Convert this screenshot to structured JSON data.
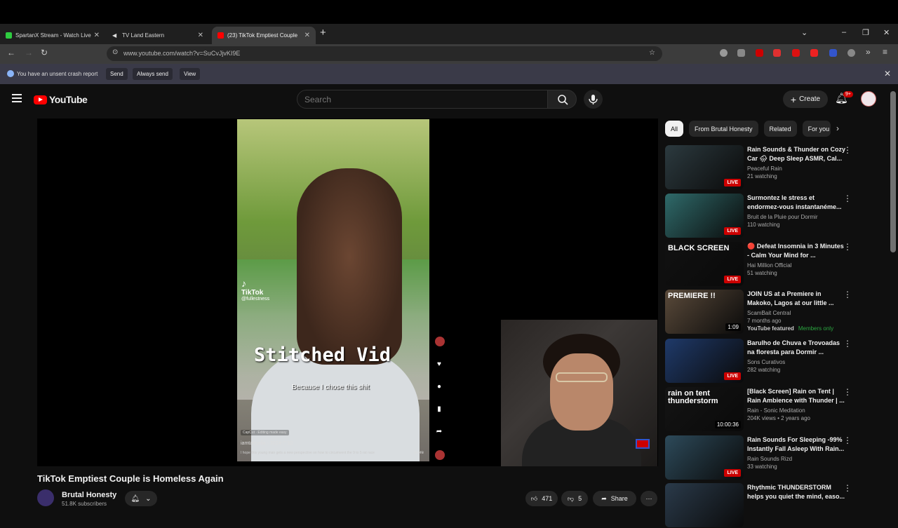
{
  "browser": {
    "tabs": [
      {
        "title": "SpartanX Stream - Watch Live o",
        "active": false,
        "color": "#2ecc40"
      },
      {
        "title": "TV Land Eastern",
        "active": false,
        "color": "#bbbbbb"
      },
      {
        "title": "(23) TikTok Emptiest Couple",
        "active": true,
        "color": "#ff0000"
      }
    ],
    "url": "www.youtube.com/watch?v=SuCvJjvKI9E",
    "infobar": {
      "message": "You have an unsent crash report",
      "send": "Send",
      "always_send": "Always send",
      "view": "View"
    }
  },
  "youtube": {
    "logo_text": "YouTube",
    "search_placeholder": "Search",
    "create_label": "Create",
    "notif_badge": "9+",
    "video": {
      "title": "TikTok Emptiest Couple is Homeless Again",
      "channel": "Brutal Honesty",
      "subscribers": "51.8K subscribers",
      "likes": "471",
      "dislikes": "5",
      "share": "Share",
      "overlay": {
        "tiktok_brand": "TikTok",
        "tiktok_handle": "@fullestness",
        "stitched": "Stitched Vid",
        "caption": "Because I chose this shit",
        "capcut": "CapCut · Editing made easy",
        "user": "iamtangelia · 2024-7-10",
        "desc": "I hope this young man gets a new perspective on how to circumvent the 9 to 5 rat race",
        "more": "more"
      }
    },
    "chips": [
      "All",
      "From Brutal Honesty",
      "Related",
      "For you"
    ],
    "recommendations": [
      {
        "title": "Rain Sounds & Thunder on Cozy Car 🌧 Deep Sleep ASMR, Cal...",
        "channel": "Peaceful Rain",
        "meta": "21 watching",
        "badge": "LIVE",
        "thumb_text": "",
        "thumb_color": "#2c3a3f"
      },
      {
        "title": "Surmontez le stress et endormez-vous instantanéme...",
        "channel": "Bruit de la Pluie pour Dormir",
        "meta": "110 watching",
        "badge": "LIVE",
        "thumb_text": "",
        "thumb_color": "#2f6a6a"
      },
      {
        "title": "🔴 Defeat Insomnia in 3 Minutes - Calm Your Mind for ...",
        "channel": "Hai Million Official",
        "meta": "51 watching",
        "badge": "LIVE",
        "thumb_text": "BLACK SCREEN",
        "thumb_color": "#111111"
      },
      {
        "title": "JOIN US at a Premiere in Makoko, Lagos at our little ...",
        "channel": "ScamBait Central",
        "meta": "7 months ago",
        "badge": "1:09",
        "thumb_text": "PREMIERE !!",
        "thumb_color": "#5a4a3a",
        "featured": "YouTube featured",
        "members": "Members only"
      },
      {
        "title": "Barulho de Chuva e Trovoadas na floresta para Dormir ...",
        "channel": "Sons Curativos",
        "meta": "282 watching",
        "badge": "LIVE",
        "thumb_text": "",
        "thumb_color": "#1f3a6a"
      },
      {
        "title": "[Black Screen] Rain on Tent | Rain Ambience with Thunder | ...",
        "channel": "Rain - Sonic Meditation",
        "meta": "204K views • 2 years ago",
        "badge": "10:00:36",
        "thumb_text": "rain on tent thunderstorm",
        "thumb_color": "#141414"
      },
      {
        "title": "Rain Sounds For Sleeping -99% Instantly Fall Asleep With Rain...",
        "channel": "Rain Sounds Rizd",
        "meta": "33 watching",
        "badge": "LIVE",
        "thumb_text": "",
        "thumb_color": "#2d4a5a"
      },
      {
        "title": "Rhythmic THUNDERSTORM helps you quiet the mind, easo...",
        "channel": "",
        "meta": "",
        "badge": "",
        "thumb_text": "",
        "thumb_color": "#2a3a4a"
      }
    ]
  }
}
